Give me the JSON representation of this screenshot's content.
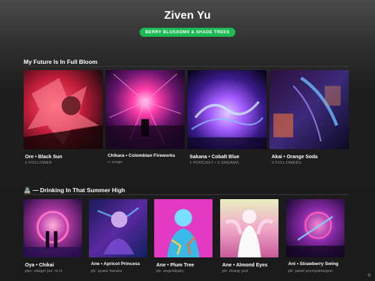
{
  "profile": {
    "name": "Ziven Yu",
    "tag": "BERRY BLOSSOMS & SHADE TREES"
  },
  "sections": [
    {
      "title": "My Future Is In Full Bloom",
      "cards": [
        {
          "title": "Ore • Black Sun",
          "subtitle": "0 FOLLOWER"
        },
        {
          "title": "Chikara • Colombian Fireworks",
          "subtitle": "∞ songs"
        },
        {
          "title": "Sakana • Cobalt Blue",
          "subtitle": "1 PODCAST • 3 DREAMS"
        },
        {
          "title": "Akai • Orange Soda",
          "subtitle": "3 FOLLOWERS"
        }
      ]
    },
    {
      "title": "🏯 — Drinking In That Summer High",
      "cards": [
        {
          "title": "Oya • Chikai",
          "subtitle": "pbs: odagiri joe, ni ni"
        },
        {
          "title": "Ane • Apricot Princess",
          "subtitle": "pb: ayase haruka"
        },
        {
          "title": "Ane • Plum Tree",
          "subtitle": "pb: angelababy"
        },
        {
          "title": "Ane • Almond Eyes",
          "subtitle": "pb: zhang yuxi"
        },
        {
          "title": "Ani • Strawberry Swing",
          "subtitle": "pb: pavel prompahaopun"
        }
      ]
    }
  ],
  "footer": {
    "copyright": "©"
  }
}
